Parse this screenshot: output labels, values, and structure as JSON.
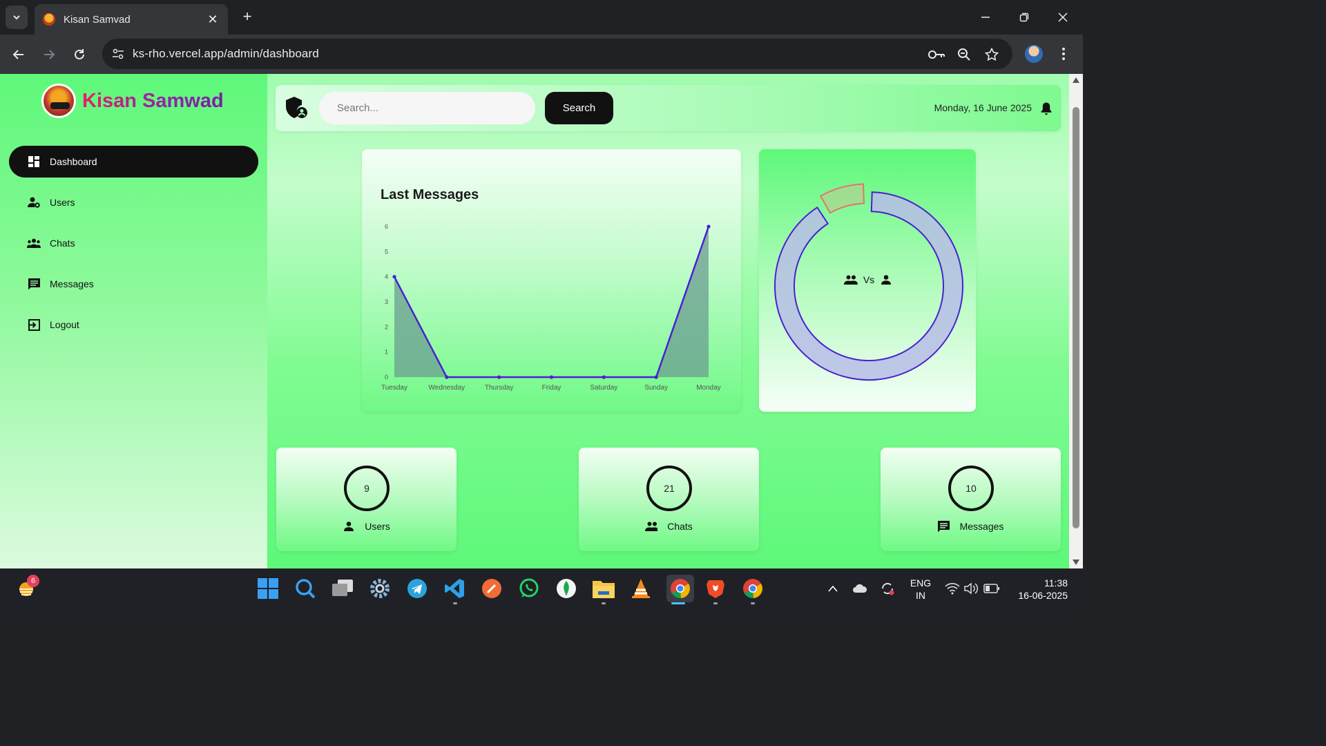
{
  "browser": {
    "tab_title": "Kisan Samvad",
    "url": "ks-rho.vercel.app/admin/dashboard"
  },
  "sidebar": {
    "brand": "Kisan Samwad",
    "items": [
      {
        "label": "Dashboard",
        "icon": "dashboard-icon",
        "active": true
      },
      {
        "label": "Users",
        "icon": "user-gear-icon"
      },
      {
        "label": "Chats",
        "icon": "group-icon"
      },
      {
        "label": "Messages",
        "icon": "message-icon"
      },
      {
        "label": "Logout",
        "icon": "logout-icon"
      }
    ]
  },
  "topbar": {
    "search_placeholder": "Search...",
    "search_button": "Search",
    "date": "Monday, 16 June 2025"
  },
  "chart_data": [
    {
      "type": "area",
      "title": "Last Messages",
      "categories": [
        "Tuesday",
        "Wednesday",
        "Thursday",
        "Friday",
        "Saturday",
        "Sunday",
        "Monday"
      ],
      "values": [
        4,
        0,
        0,
        0,
        0,
        0,
        6
      ],
      "yticks": [
        0,
        1,
        2,
        3,
        4,
        5,
        6
      ],
      "ylim": [
        0,
        6
      ],
      "line_color": "#4a1fd1",
      "fill_color": "#6b9e92"
    },
    {
      "type": "pie",
      "subtype": "doughnut",
      "center_text": "Vs",
      "slices": [
        {
          "icon": "group-icon",
          "value": 21,
          "color": "#b7bde6",
          "border": "#4a1fd1"
        },
        {
          "icon": "user-icon",
          "value": 2,
          "color": "#a6d98f",
          "border": "#e57373"
        }
      ]
    }
  ],
  "stats": [
    {
      "value": "9",
      "label": "Users",
      "icon": "user-icon"
    },
    {
      "value": "21",
      "label": "Chats",
      "icon": "group-icon"
    },
    {
      "value": "10",
      "label": "Messages",
      "icon": "message-icon"
    }
  ],
  "taskbar": {
    "weather_badge": "6",
    "lang_line1": "ENG",
    "lang_line2": "IN",
    "time": "11:38",
    "date": "16-06-2025"
  }
}
